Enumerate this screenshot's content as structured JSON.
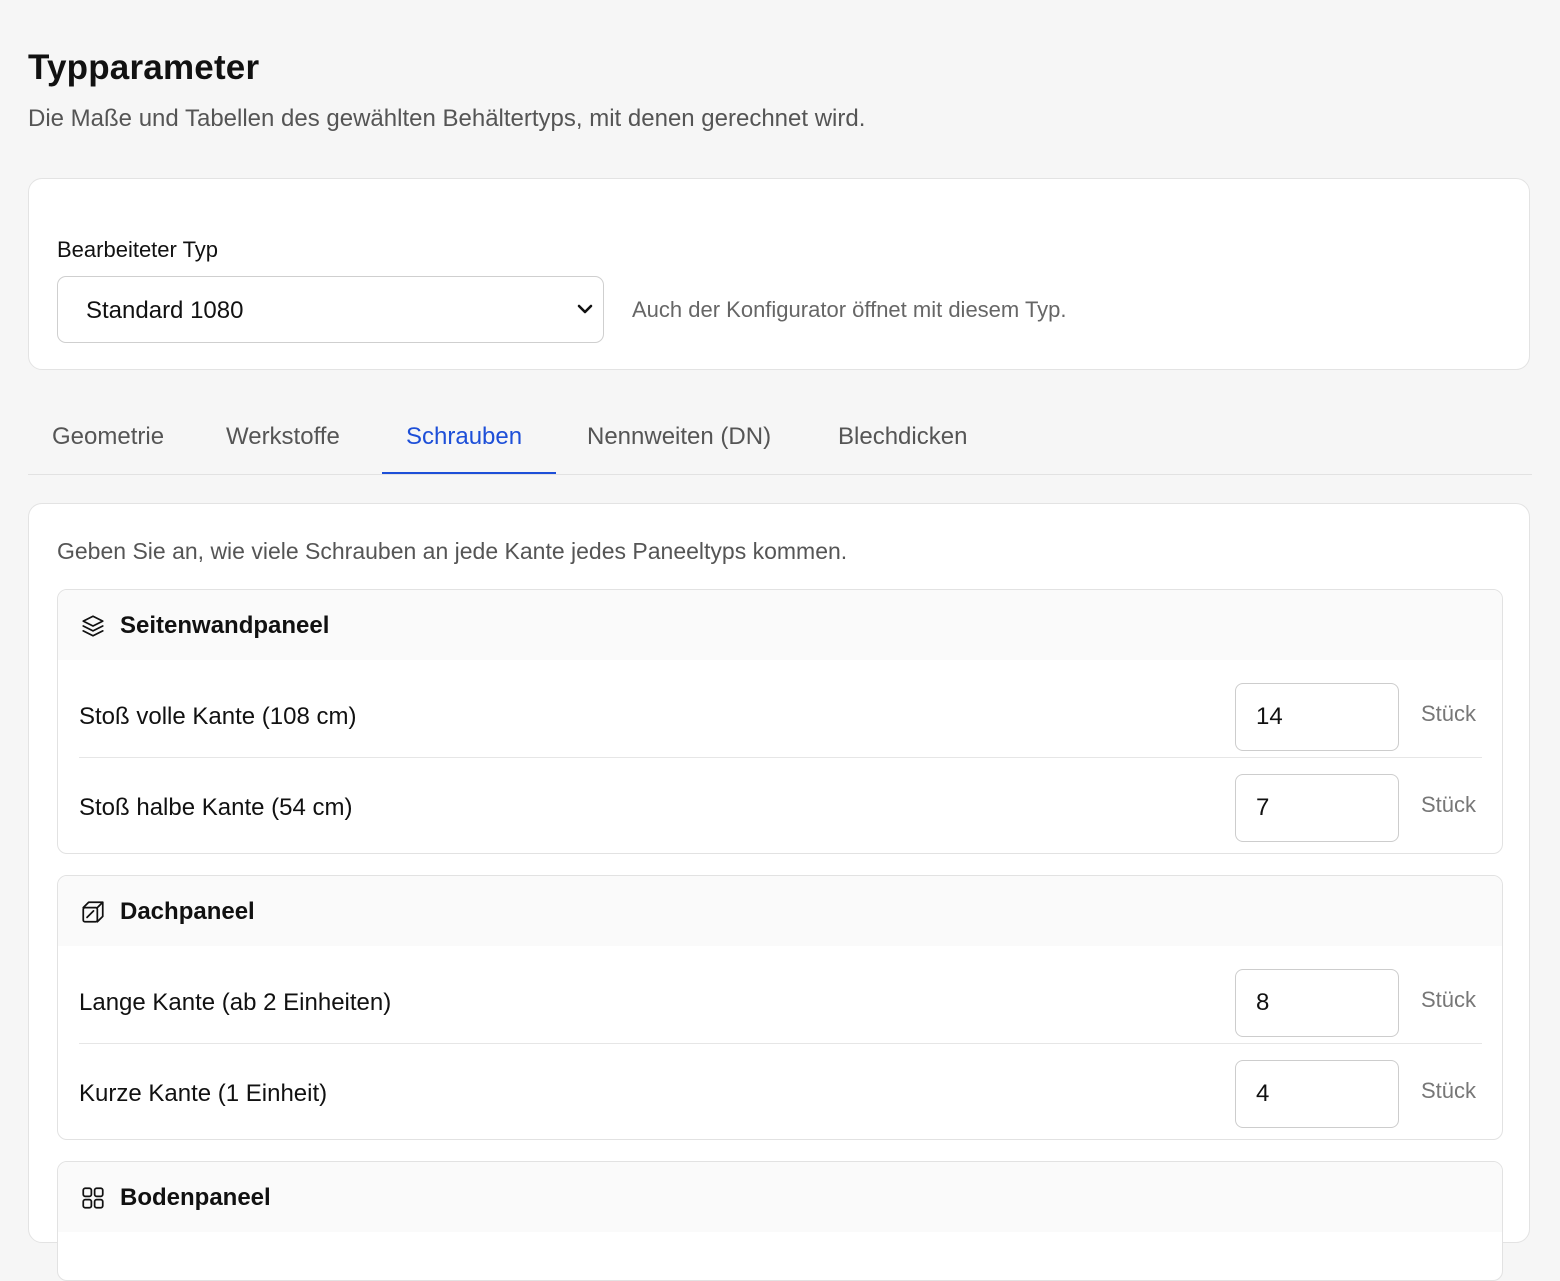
{
  "page": {
    "title": "Typparameter",
    "subtitle": "Die Maße und Tabellen des gewählten Behältertyps, mit denen gerechnet wird."
  },
  "type_selector": {
    "label": "Bearbeiteter Typ",
    "selected": "Standard 1080",
    "hint": "Auch der Konfigurator öffnet mit diesem Typ."
  },
  "tabs": [
    {
      "label": "Geometrie",
      "active": false
    },
    {
      "label": "Werkstoffe",
      "active": false
    },
    {
      "label": "Schrauben",
      "active": true
    },
    {
      "label": "Nennweiten (DN)",
      "active": false
    },
    {
      "label": "Blechdicken",
      "active": false
    }
  ],
  "content": {
    "intro": "Geben Sie an, wie viele Schrauben an jede Kante jedes Paneeltyps kommen.",
    "panels": [
      {
        "title": "Seitenwandpaneel",
        "icon": "layers-icon",
        "rows": [
          {
            "label": "Stoß volle Kante (108 cm)",
            "value": "14",
            "unit": "Stück"
          },
          {
            "label": "Stoß halbe Kante (54 cm)",
            "value": "7",
            "unit": "Stück"
          }
        ]
      },
      {
        "title": "Dachpaneel",
        "icon": "box-icon",
        "rows": [
          {
            "label": "Lange Kante (ab 2 Einheiten)",
            "value": "8",
            "unit": "Stück"
          },
          {
            "label": "Kurze Kante (1 Einheit)",
            "value": "4",
            "unit": "Stück"
          }
        ]
      },
      {
        "title": "Bodenpaneel",
        "icon": "grid-icon",
        "rows": []
      }
    ]
  },
  "colors": {
    "accent": "#1d4fd8",
    "background": "#f6f6f6",
    "card": "#ffffff",
    "border": "#e3e3e3"
  }
}
